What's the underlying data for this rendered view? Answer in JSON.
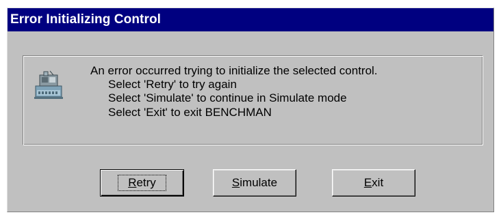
{
  "dialog": {
    "title": "Error Initializing Control",
    "title_bar_color": "#000080",
    "face_color": "#c0c0c0",
    "icon": "benchman-machine-icon",
    "message_lines": [
      "An error occurred trying to initialize the selected control.",
      "Select 'Retry' to try again",
      "Select 'Simulate' to continue in Simulate mode",
      "Select 'Exit' to exit BENCHMAN"
    ],
    "buttons": {
      "retry": {
        "mnemonic": "R",
        "rest": "etry"
      },
      "simulate": {
        "mnemonic": "S",
        "rest": "imulate"
      },
      "exit": {
        "mnemonic": "E",
        "rest": "xit"
      }
    },
    "default_button": "Retry"
  }
}
